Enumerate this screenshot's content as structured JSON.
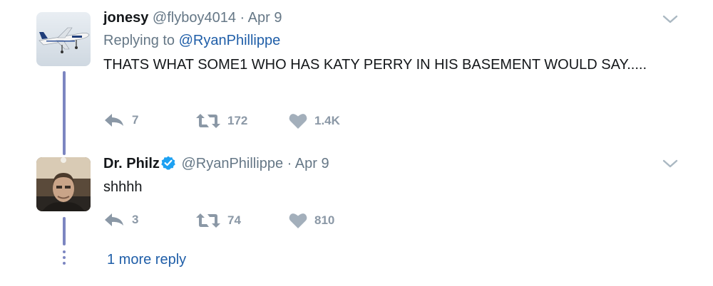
{
  "tweets": [
    {
      "name": "jonesy",
      "handle": "@flyboy4014",
      "separator": "·",
      "date": "Apr 9",
      "replying_prefix": "Replying to",
      "replying_to": "@RyanPhillippe",
      "text": "THATS WHAT SOME1 WHO HAS KATY PERRY IN HIS BASEMENT WOULD SAY.....",
      "replies": "7",
      "retweets": "172",
      "likes": "1.4K",
      "avatar_icon": "airplane-photo"
    },
    {
      "name": "Dr. Philz",
      "verified": true,
      "handle": "@RyanPhillippe",
      "separator": "·",
      "date": "Apr 9",
      "text": "shhhh",
      "replies": "3",
      "retweets": "74",
      "likes": "810",
      "avatar_icon": "person-photo"
    }
  ],
  "more_replies": "1 more reply",
  "colors": {
    "thread_line": "#7c86c1",
    "link": "#1f5ea8",
    "muted": "#657786",
    "action_gray": "#8b98a6",
    "verified": "#1da1f2"
  }
}
